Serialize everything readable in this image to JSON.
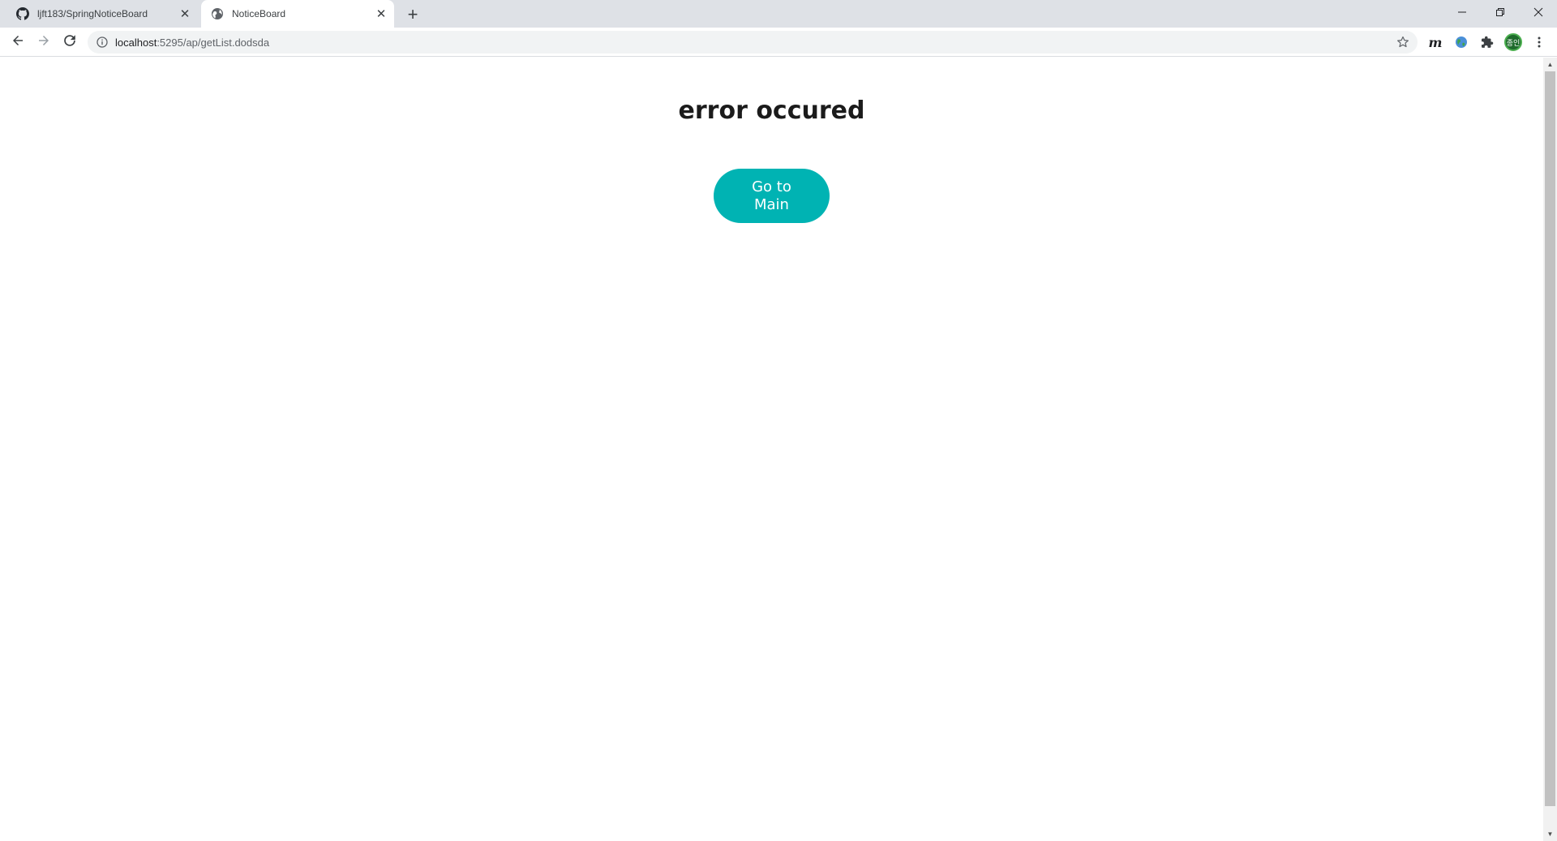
{
  "browser": {
    "tabs": [
      {
        "title": "ljft183/SpringNoticeBoard",
        "favicon": "github-icon",
        "active": false
      },
      {
        "title": "NoticeBoard",
        "favicon": "globe-icon",
        "active": true
      }
    ],
    "new_tab_label": "+",
    "address_bar": {
      "host": "localhost",
      "path": ":5295/ap/getList.dodsda"
    },
    "extensions": {
      "m_label": "m",
      "profile_label": "종인"
    },
    "window_controls": {
      "minimize": "—",
      "restore": "❐",
      "close": "✕"
    }
  },
  "page": {
    "heading": "error occured",
    "main_button_label": "Go to Main",
    "accent_color": "#00b3b3"
  }
}
